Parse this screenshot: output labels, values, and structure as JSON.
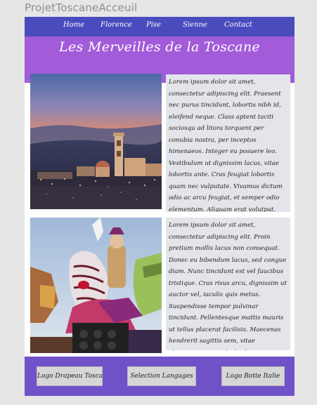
{
  "window": {
    "title": "ProjetToscaneAcceuil"
  },
  "nav": {
    "items": [
      {
        "label": "Home"
      },
      {
        "label": "Florence"
      },
      {
        "label": "Pise"
      },
      {
        "label": "Sienne"
      },
      {
        "label": "Contact"
      }
    ]
  },
  "banner": {
    "title": "Les Merveilles de la Toscane"
  },
  "main": {
    "images": [
      {
        "name": "florence-cityscape-image"
      },
      {
        "name": "carnival-float-image"
      }
    ],
    "paragraphs": [
      "Lorem ipsum dolor sit amet, consectetur adipiscing elit. Praesent nec purus tincidunt, lobortis nibh id, eleifend neque. Class aptent taciti sociosqu ad litora torquent per conubia nostra, per inceptos himenaeos. Integer eu posuere leo. Vestibulum ut dignissim lacus, vitae lobortis ante. Cras feugiat lobortis quam nec vulputate. Vivamus dictum odio ac arcu feugiat, et semper odio elementum. Aliquam erat volutpat. Etiam purus nulla, ultricies ut fringilla et, lobortis sed nunc. Cras odio sem, viverra eu ligula laoreet, ultricies pulvinar tortor. Suspendisse iaculis ipsum ut",
      "Lorem ipsum dolor sit amet, consectetur adipiscing elit. Proin pretium mollis lacus non consequat. Donec eu bibendum lacus, sed congue diam. Nunc tincidunt est vel faucibus tristique. Cras risus arcu, dignissim ut auctor vel, iaculis quis metus. Suspendisse tempor pulvinar tincidunt. Pellentesque mattis mauris ut tellus placerat facilisis. Maecenas hendrerit sagittis sem, vitae elementum nunc eleifend eget. Ut interdum eros ac sem pharetra, vitae accumsan urna venenatis. Nam placerat."
    ]
  },
  "footer": {
    "buttons": [
      {
        "label": "Logo Drapeau Toscane"
      },
      {
        "label": "Selection Langages"
      },
      {
        "label": "Logo Botte Italie"
      }
    ]
  },
  "colors": {
    "nav": "#4a4bbd",
    "banner": "#a25bd9",
    "footer": "#7052c8",
    "text_bg": "#e3e5ea"
  }
}
